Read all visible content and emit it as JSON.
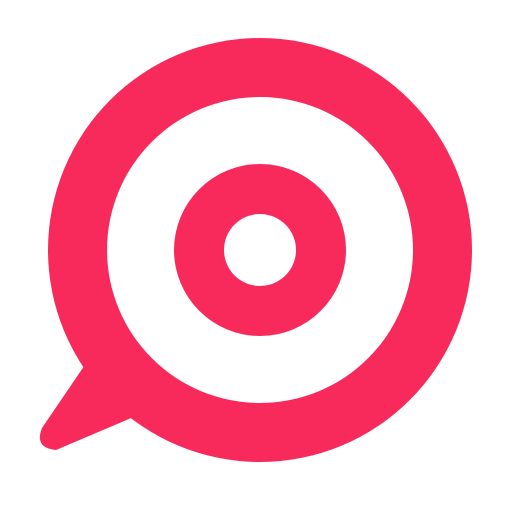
{
  "icon": {
    "name": "target-speech-bubble-icon",
    "colors": {
      "primary": "#F72A5B",
      "background": "#FFFFFF"
    }
  }
}
